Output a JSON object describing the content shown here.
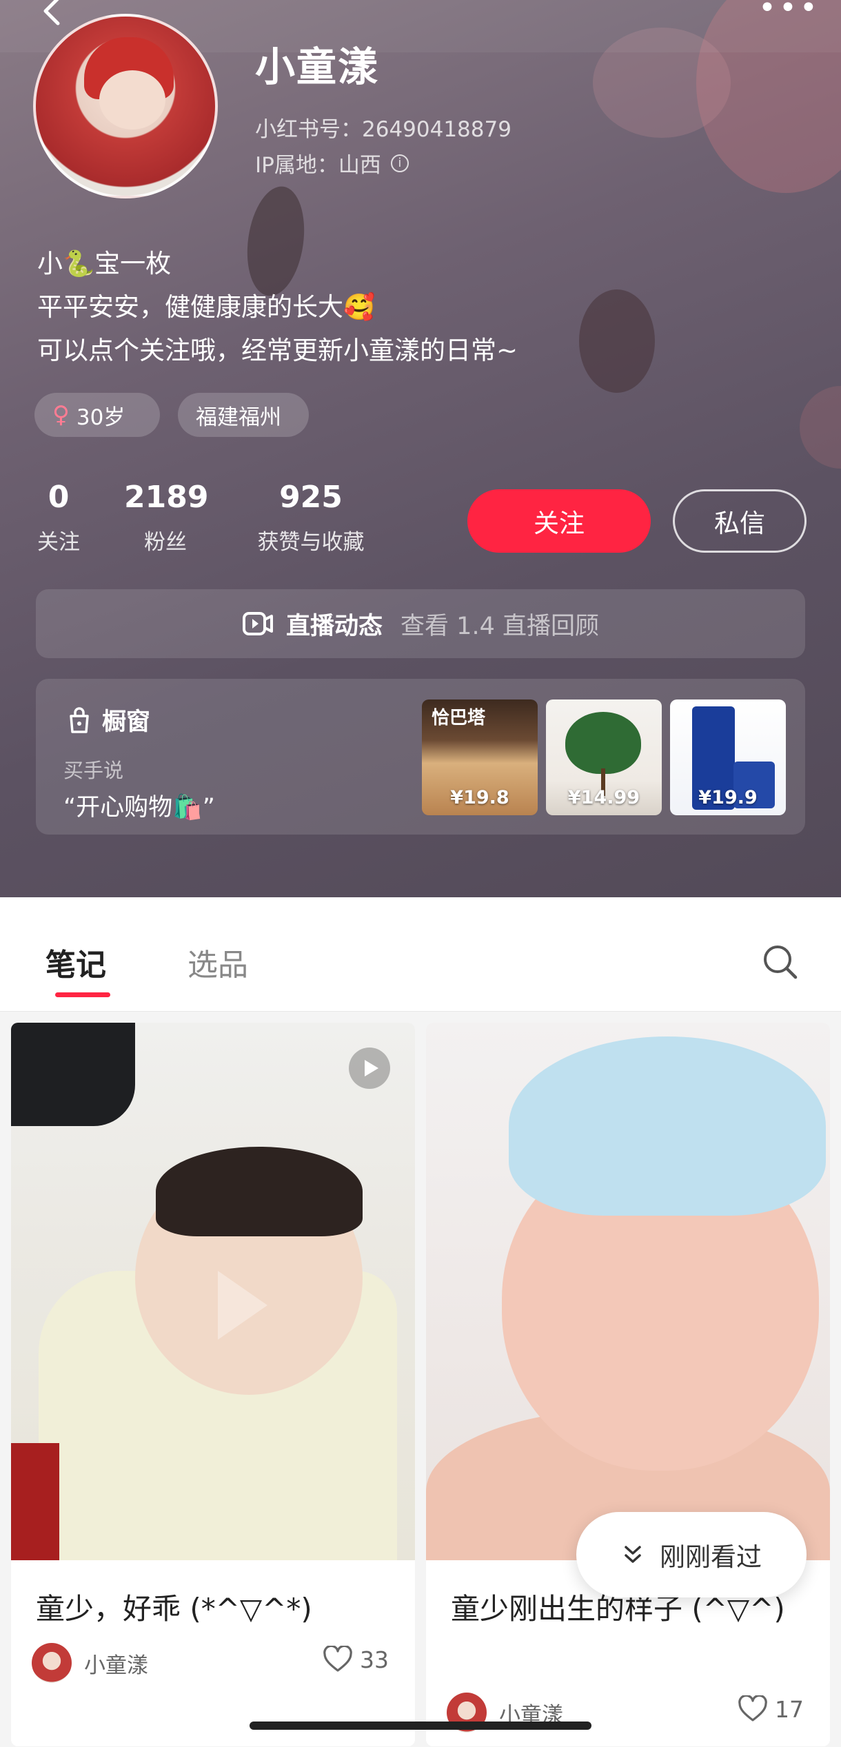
{
  "profile": {
    "nickname": "小童漾",
    "id_line": "小红书号：26490418879",
    "ip_line": "IP属地：山西",
    "bio": [
      "小🐍宝一枚",
      "平平安安，健健康康的长大🥰",
      "可以点个关注哦，经常更新小童漾的日常~"
    ],
    "tags": {
      "age": "30岁",
      "location": "福建福州"
    }
  },
  "stats": {
    "following": {
      "value": "0",
      "label": "关注"
    },
    "fans": {
      "value": "2189",
      "label": "粉丝"
    },
    "likes": {
      "value": "925",
      "label": "获赞与收藏"
    }
  },
  "actions": {
    "follow": "关注",
    "message": "私信"
  },
  "live": {
    "title": "直播动态",
    "subtitle": "查看 1.4 直播回顾"
  },
  "shop": {
    "title": "橱窗",
    "subtitle": "买手说",
    "quote": "“开心购物🛍️”",
    "products": [
      {
        "brand": "恰巴塔",
        "price": "¥19.8"
      },
      {
        "price": "¥14.99"
      },
      {
        "price": "¥19.9"
      }
    ]
  },
  "tabs": {
    "notes": "笔记",
    "picks": "选品"
  },
  "notes": [
    {
      "title": "童少，好乖 (*^▽^*)",
      "author": "小童漾",
      "likes": "33"
    },
    {
      "title": "童少刚出生的样子 (^▽^)",
      "author": "小童漾",
      "likes": "17"
    }
  ],
  "recently_viewed": "刚刚看过",
  "colors": {
    "accent": "#ff2442",
    "header_bg": "#5e5464"
  }
}
